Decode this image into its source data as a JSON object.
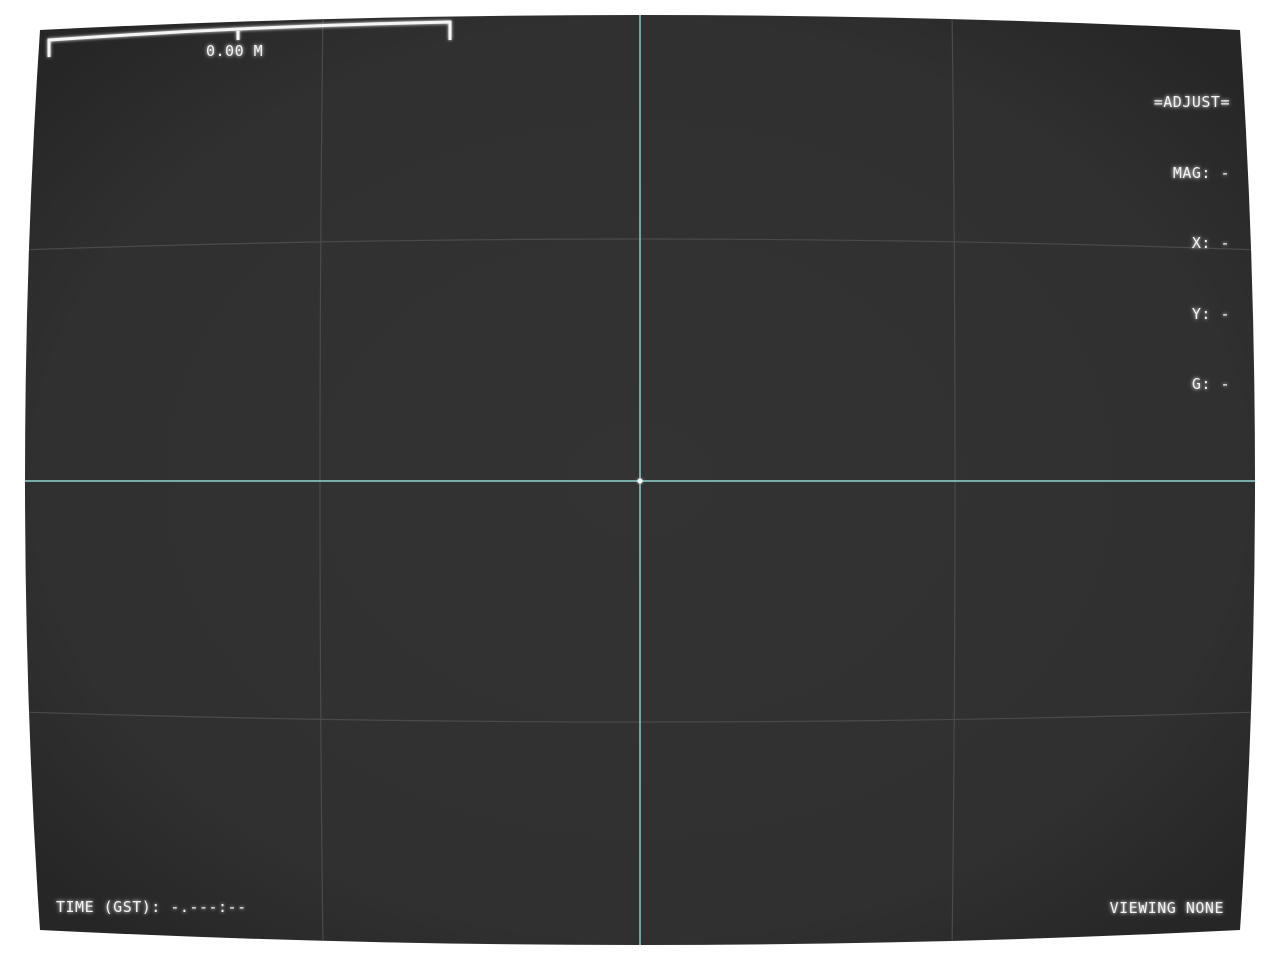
{
  "scale_bar": {
    "label": "0.00 M"
  },
  "adjust_panel": {
    "title": "=ADJUST=",
    "mag": "MAG: -",
    "x": "X: -",
    "y": "Y: -",
    "g": "G: -"
  },
  "footer": {
    "time": "TIME (GST): -.---:--",
    "viewing": "VIEWING NONE"
  },
  "colors": {
    "screen": "#303030",
    "grid": "#4a4a4a",
    "crosshair": "#8fd6d2",
    "text": "#f2f2f2"
  }
}
